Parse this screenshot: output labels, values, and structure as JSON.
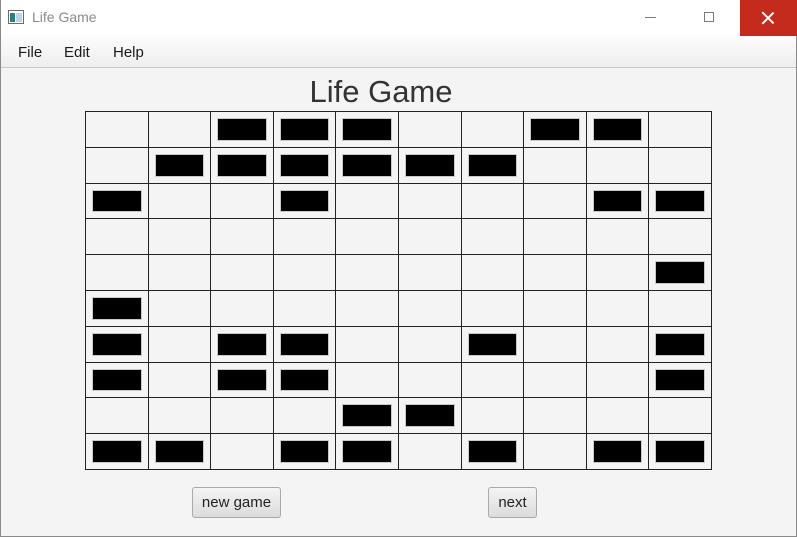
{
  "window": {
    "title": "Life Game"
  },
  "menu": {
    "items": [
      "File",
      "Edit",
      "Help"
    ]
  },
  "page": {
    "title": "Life Game"
  },
  "board": {
    "rows": 10,
    "cols": 10,
    "cells": [
      [
        0,
        0,
        1,
        1,
        1,
        0,
        0,
        1,
        1,
        0
      ],
      [
        0,
        1,
        1,
        1,
        1,
        1,
        1,
        0,
        0,
        0
      ],
      [
        1,
        0,
        0,
        1,
        0,
        0,
        0,
        0,
        1,
        1
      ],
      [
        0,
        0,
        0,
        0,
        0,
        0,
        0,
        0,
        0,
        0
      ],
      [
        0,
        0,
        0,
        0,
        0,
        0,
        0,
        0,
        0,
        1
      ],
      [
        1,
        0,
        0,
        0,
        0,
        0,
        0,
        0,
        0,
        0
      ],
      [
        1,
        0,
        1,
        1,
        0,
        0,
        1,
        0,
        0,
        1
      ],
      [
        1,
        0,
        1,
        1,
        0,
        0,
        0,
        0,
        0,
        1
      ],
      [
        0,
        0,
        0,
        0,
        1,
        1,
        0,
        0,
        0,
        0
      ],
      [
        1,
        1,
        0,
        1,
        1,
        0,
        1,
        0,
        1,
        1
      ]
    ]
  },
  "buttons": {
    "new_game": "new game",
    "next": "next"
  }
}
